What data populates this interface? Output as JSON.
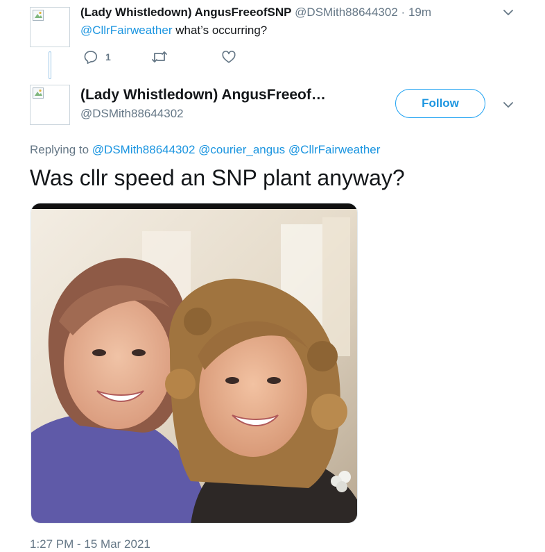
{
  "reply_tweet": {
    "display_name": "(Lady Whistledown) AngusFreeofSNP",
    "handle": "@DSMith88644302",
    "separator": "·",
    "time_ago": "19m",
    "mention": "@CllrFairweather",
    "text": "what’s occurring?",
    "reply_count": "1"
  },
  "main_tweet": {
    "display_name": "(Lady Whistledown) AngusFreeof…",
    "handle": "@DSMith88644302",
    "follow_label": "Follow",
    "replying_to_label": "Replying to",
    "replying_to": [
      "@DSMith88644302",
      "@courier_angus",
      "@CllrFairweather"
    ],
    "text": "Was cllr speed an SNP plant anyway?",
    "timestamp": "1:27 PM - 15 Mar 2021"
  },
  "colors": {
    "link": "#1b95e0",
    "muted": "#657786",
    "text": "#14171a",
    "border": "#ccd6dd"
  },
  "icons": [
    "reply-icon",
    "retweet-icon",
    "like-icon",
    "chevron-down-icon"
  ]
}
